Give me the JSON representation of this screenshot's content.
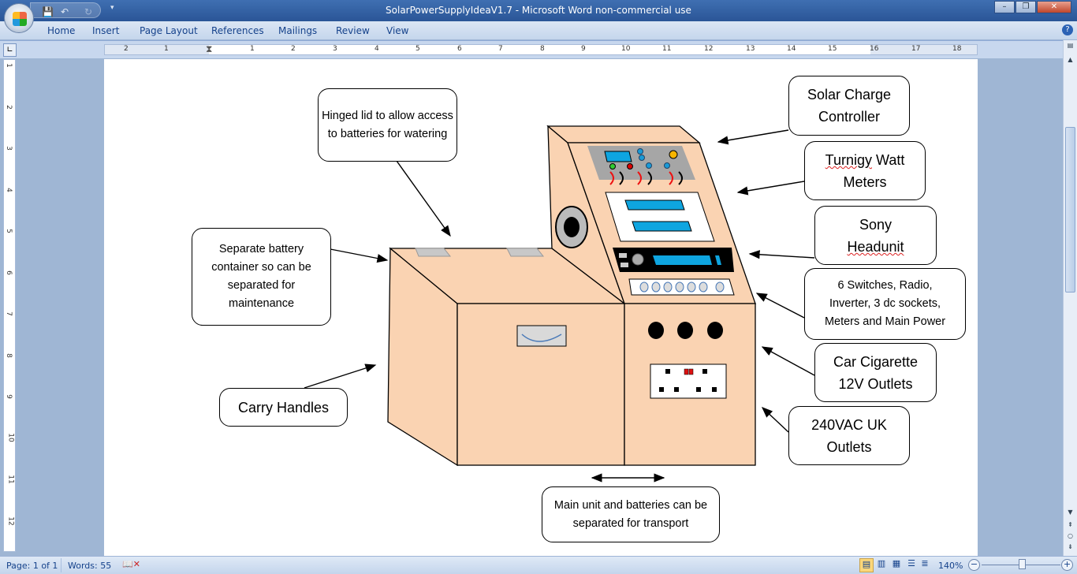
{
  "window": {
    "title": "SolarPowerSupplyIdeaV1.7 - Microsoft Word non-commercial use"
  },
  "ribbon": {
    "tabs": [
      "Home",
      "Insert",
      "Page Layout",
      "References",
      "Mailings",
      "Review",
      "View"
    ]
  },
  "ruler": {
    "h_left": [
      "2",
      "1"
    ],
    "h_right": [
      "1",
      "2",
      "3",
      "4",
      "5",
      "6",
      "7",
      "8",
      "9",
      "10",
      "11",
      "12",
      "13",
      "14",
      "15",
      "16",
      "17",
      "18"
    ],
    "v": [
      "1",
      "2",
      "3",
      "4",
      "5",
      "6",
      "7",
      "8",
      "9",
      "10",
      "11",
      "12"
    ]
  },
  "diagram": {
    "callouts": {
      "hinged_lid": "Hinged lid to allow access to batteries for watering",
      "separate_battery": "Separate battery container so can be separated for maintenance",
      "carry_handles": "Carry Handles",
      "solar_charge": "Solar Charge Controller",
      "turnigy_a": "Turnigy",
      "turnigy_b": " Watt Meters",
      "sony_a": "Sony",
      "sony_b": "Headunit",
      "switches": "6 Switches, Radio, Inverter, 3 dc sockets, Meters and Main Power",
      "car_cig": "Car Cigarette 12V Outlets",
      "uk_outlets": "240VAC UK Outlets",
      "main_unit": "Main unit and batteries can be separated for transport"
    },
    "colors": {
      "body": "#fad3b2",
      "panel": "#a6a6a6",
      "display": "#0ea5e0",
      "headunit": "#000000"
    }
  },
  "status": {
    "page": "Page: 1 of 1",
    "words": "Words: 55",
    "zoom": "140%"
  }
}
